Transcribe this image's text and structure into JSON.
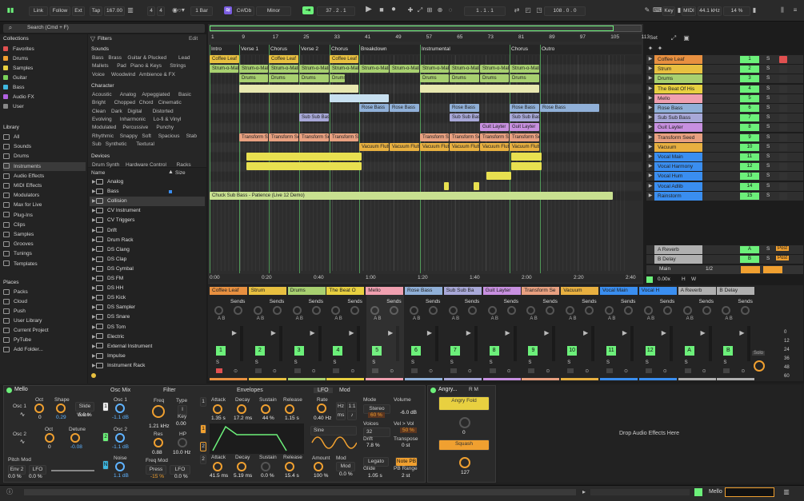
{
  "transport": {
    "link": "Link",
    "follow": "Follow",
    "ext": "Ext",
    "tap": "Tap",
    "tempo": "167.00",
    "sig_num": "4",
    "sig_den": "4",
    "quant": "1 Bar",
    "key": "C#/Db",
    "scale": "Minor",
    "position": "37 . 2 . 1",
    "loop_start": "1 . 1 . 1",
    "loop_len": "108 . 0 . 0",
    "key_btn": "Key",
    "midi_btn": "MIDI",
    "sample_rate": "44.1 kHz",
    "cpu": "14 %"
  },
  "search": {
    "placeholder": "Search (Cmd + F)"
  },
  "collections": {
    "title": "Collections",
    "items": [
      {
        "label": "Favorites",
        "color": "#e05050"
      },
      {
        "label": "Drums",
        "color": "#f0a030"
      },
      {
        "label": "Samples",
        "color": "#e8d040"
      },
      {
        "label": "Guitar",
        "color": "#7ad35a"
      },
      {
        "label": "Bass",
        "color": "#3fb8e0"
      },
      {
        "label": "Audio FX",
        "color": "#b060e0"
      },
      {
        "label": "User",
        "color": "#888888"
      }
    ]
  },
  "library": {
    "title": "Library",
    "items": [
      "All",
      "Sounds",
      "Drums",
      "Instruments",
      "Audio Effects",
      "MIDI Effects",
      "Modulators",
      "Max for Live",
      "Plug-Ins",
      "Clips",
      "Samples",
      "Grooves",
      "Tunings",
      "Templates"
    ]
  },
  "places": {
    "title": "Places",
    "items": [
      "Packs",
      "Cloud",
      "Push",
      "User Library",
      "Current Project",
      "PyTube",
      "Add Folder..."
    ]
  },
  "filters": {
    "title": "Filters",
    "edit": "Edit",
    "sounds_label": "Sounds",
    "sounds_tags": [
      "Bass",
      "Brass",
      "Guitar & Plucked",
      "Lead",
      "Mallets",
      "Pad",
      "Piano & Keys",
      "Strings",
      "Voice",
      "Woodwind",
      "Ambience & FX"
    ],
    "character_label": "Character",
    "character_tags": [
      "Acoustic",
      "Analog",
      "Arpeggiated",
      "Basic",
      "Bright",
      "Chopped",
      "Chord",
      "Cinematic",
      "Clean",
      "Dark",
      "Digital",
      "Distorted",
      "Evolving",
      "Inharmonic",
      "Lo-fi & Vinyl",
      "Modulated",
      "Percussive",
      "Punchy",
      "Rhythmic",
      "Snappy",
      "Soft",
      "Spacious",
      "Stab",
      "Sub",
      "Synthetic",
      "Textural"
    ],
    "devices_label": "Devices",
    "devices_tags": [
      "Drum Synth",
      "Hardware Control",
      "Racks"
    ]
  },
  "browser": {
    "name_col": "Name",
    "size_col": "Size",
    "rows": [
      "Analog",
      "Bass",
      "Collision",
      "CV Instrument",
      "CV Triggers",
      "Drift",
      "Drum Rack",
      "DS Clang",
      "DS Clap",
      "DS Cymbal",
      "DS FM",
      "DS HH",
      "DS Kick",
      "DS Sampler",
      "DS Snare",
      "DS Tom",
      "Electric",
      "External Instrument",
      "Impulse",
      "Instrument Rack"
    ]
  },
  "ruler": {
    "bars": [
      "1",
      "9",
      "17",
      "25",
      "33",
      "41",
      "49",
      "57",
      "65",
      "73",
      "81",
      "89",
      "97",
      "105",
      "113"
    ],
    "set": "Set"
  },
  "locators": [
    "Intro",
    "Verse 1",
    "Chorus",
    "Verse 2",
    "Chorus",
    "Breakdown",
    "Instrumental",
    "Chorus",
    "Outro"
  ],
  "timeline": [
    "0:00",
    "0:20",
    "0:40",
    "1:00",
    "1:20",
    "1:40",
    "2:00",
    "2:20",
    "2:40"
  ],
  "clips": {
    "coffee": "Coffee Leaf",
    "strum": "Strum-o-Matic",
    "drums": "Drums",
    "rose": "Rose Bass",
    "sub": "Sub Sub Bass",
    "guit": "Guit Layter",
    "trans": "Transform Seed",
    "vac": "Vacuum Flutter",
    "chuck": "Chuck Sub Bass - Patience (Live 12 Demo)"
  },
  "tracks": [
    {
      "name": "Coffee Leaf",
      "num": "1",
      "color": "#e89040"
    },
    {
      "name": "Strum",
      "num": "2",
      "color": "#e8c040"
    },
    {
      "name": "Drums",
      "num": "3",
      "color": "#a8d070"
    },
    {
      "name": "The Beat Of His",
      "num": "4",
      "color": "#e8d040"
    },
    {
      "name": "Mello",
      "num": "5",
      "color": "#f0a0b0"
    },
    {
      "name": "Rose Bass",
      "num": "6",
      "color": "#90b0d8"
    },
    {
      "name": "Sub Sub Bass",
      "num": "7",
      "color": "#a8a8d8"
    },
    {
      "name": "Guit Layter",
      "num": "8",
      "color": "#c890e0"
    },
    {
      "name": "Transform Seed",
      "num": "9",
      "color": "#e8a080"
    },
    {
      "name": "Vacuum",
      "num": "10",
      "color": "#e8b040"
    },
    {
      "name": "Vocal Main",
      "num": "11",
      "color": "#3a8ef0"
    },
    {
      "name": "Vocal Harmony",
      "num": "12",
      "color": "#3a8ef0"
    },
    {
      "name": "Vocal Hum",
      "num": "13",
      "color": "#3a8ef0"
    },
    {
      "name": "Vocal Adlib",
      "num": "14",
      "color": "#3a8ef0"
    },
    {
      "name": "Rainstorm",
      "num": "15",
      "color": "#3a8ef0"
    }
  ],
  "returns": [
    {
      "name": "A Reverb",
      "letter": "A",
      "post": "Post"
    },
    {
      "name": "B Delay",
      "letter": "B",
      "post": "Post"
    }
  ],
  "main": {
    "name": "Main",
    "cue": "1/2",
    "zoom": "0.00x"
  },
  "mixer": {
    "sends_label": "Sends",
    "channels": [
      {
        "name": "Coffee Leaf",
        "num": "1",
        "color": "#e89040"
      },
      {
        "name": "Strum",
        "num": "2",
        "color": "#e8c040"
      },
      {
        "name": "Drums",
        "num": "3",
        "color": "#a8d070"
      },
      {
        "name": "The Beat O",
        "num": "4",
        "color": "#e8d040"
      },
      {
        "name": "Mello",
        "num": "5",
        "color": "#f0a0b0"
      },
      {
        "name": "Rose Bass",
        "num": "6",
        "color": "#90b0d8"
      },
      {
        "name": "Sub Sub Ba",
        "num": "7",
        "color": "#a8a8d8"
      },
      {
        "name": "Guit Layter",
        "num": "8",
        "color": "#c890e0"
      },
      {
        "name": "Transform Se",
        "num": "9",
        "color": "#e8a080"
      },
      {
        "name": "Vacuum",
        "num": "10",
        "color": "#e8b040"
      },
      {
        "name": "Vocal Main",
        "num": "11",
        "color": "#3a8ef0"
      },
      {
        "name": "Vocal H",
        "num": "12",
        "color": "#3a8ef0"
      },
      {
        "name": "A Reverb",
        "num": "A",
        "color": "#b0b0b0"
      },
      {
        "name": "B Delay",
        "num": "B",
        "color": "#b0b0b0"
      }
    ],
    "db": [
      "0",
      "12",
      "24",
      "36",
      "48",
      "60"
    ],
    "solo": "Solo"
  },
  "device": {
    "name": "Mello",
    "osc1": "Osc 1",
    "oct": "Oct",
    "shape": "Shape",
    "slide": "Slide",
    "osc1_oct": "0",
    "osc1_shape": "0.29",
    "voice": "Voice",
    "voice_val": "5.0 %",
    "osc2": "Osc 2",
    "osc2_oct": "0",
    "detune": "Detune",
    "detune_val": "-0.08",
    "oscmix": "Osc Mix",
    "mix1": "Osc 1",
    "mix1_val": "-1.1 dB",
    "mix2": "Osc 2",
    "mix2_val": "-1.1 dB",
    "noise": "Noise",
    "noise_val": "1.1 dB",
    "pitchmod": "Pitch Mod",
    "env2": "Env 2",
    "lfo": "LFO",
    "pm1": "0.0 %",
    "pm2": "0.0 %",
    "filter": "Filter",
    "freq": "Freq",
    "freq_val": "1.21 kHz",
    "type": "Type",
    "type_val": "I",
    "key": "Key",
    "key_val": "0.00",
    "res": "Res",
    "res_val": "0.88",
    "hp": "HP",
    "hp_val": "10.0 Hz",
    "freqmod": "Freq Mod",
    "press": "Press",
    "lfo2": "LFO",
    "fm1": "-15 %",
    "fm2": "0.0 %",
    "envelopes": "Envelopes",
    "attack": "Attack",
    "decay": "Decay",
    "sustain": "Sustain",
    "release": "Release",
    "e1_attack": "1.35 s",
    "e1_decay": "17.2 ms",
    "e1_sustain": "44 %",
    "e1_release": "1.15 s",
    "e2_attack": "41.5 ms",
    "e2_decay": "5.19 ms",
    "e2_sustain": "0.0 %",
    "e2_release": "15.4 s",
    "lfo_tab": "LFO",
    "mod_tab": "Mod",
    "rate": "Rate",
    "rate_val": "0.40 Hz",
    "sine": "Sine",
    "amount": "Amount",
    "amount_val": "100 %",
    "mod": "Mod",
    "mod_val": "0.0 %",
    "mode": "Mode",
    "mode_val": "Stereo",
    "mode_pct": "60 %",
    "voices": "Voices",
    "voices_val": "32",
    "drift": "Drift",
    "drift_val": "7.8 %",
    "legato": "Legato",
    "glide": "Glide",
    "glide_val": "1.05 s",
    "volume": "Volume",
    "volume_val": "-6.0 dB",
    "velvol": "Vel > Vol",
    "velvol_val": "50 %",
    "transpose": "Transpose",
    "transpose_val": "0 st",
    "noteon": "Note PB",
    "pbrange": "PB Range",
    "pbrange_val": "2 st"
  },
  "rack": {
    "name": "Angry...",
    "pad1": "Angry Fold",
    "pad2": "Squash",
    "knob_val": "0",
    "knob2_val": "127"
  },
  "drop": {
    "text": "Drop Audio Effects Here"
  },
  "status": {
    "track": "Mello"
  }
}
